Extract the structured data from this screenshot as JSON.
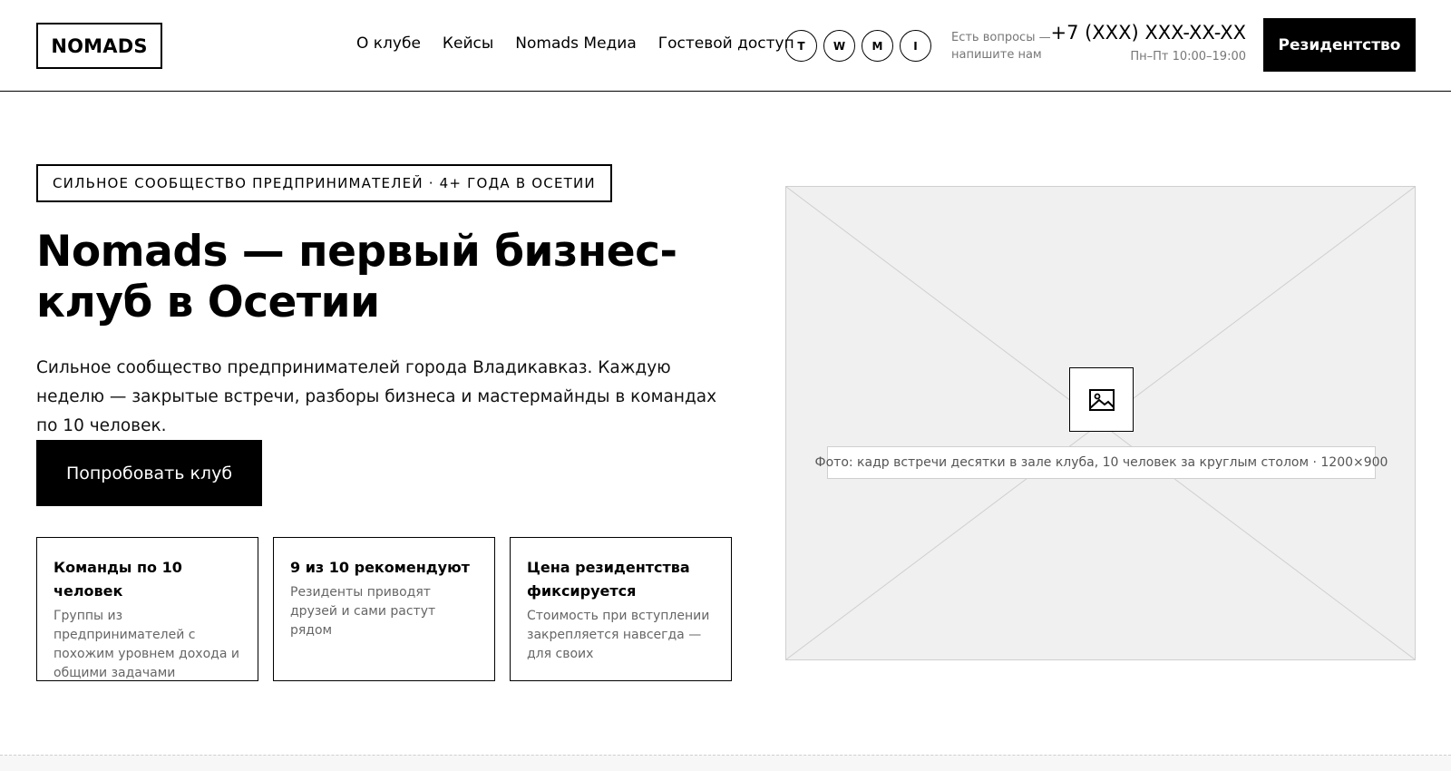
{
  "header": {
    "logo": "NOMADS",
    "nav": [
      {
        "label": "О клубе"
      },
      {
        "label": "Кейсы"
      },
      {
        "label": "Nomads Медиа"
      },
      {
        "label": "Гостевой доступ"
      }
    ],
    "socials": [
      {
        "letter": "T",
        "icon": "telegram-icon"
      },
      {
        "letter": "W",
        "icon": "whatsapp-icon"
      },
      {
        "letter": "M",
        "icon": "max-icon"
      },
      {
        "letter": "I",
        "icon": "instagram-icon"
      }
    ],
    "questions_line1": "Есть вопросы —",
    "questions_line2": "напишите нам",
    "phone": "+7 (XXX) XXX-XX-XX",
    "hours": "Пн–Пт 10:00–19:00",
    "cta": "Резидентство"
  },
  "hero": {
    "tag": "СИЛЬНОЕ СООБЩЕСТВО ПРЕДПРИНИМАТЕЛЕЙ · 4+ ГОДА В ОСЕТИИ",
    "title": "Nomads — первый бизнес-клуб в Осетии",
    "subtitle": "Сильное сообщество предпринимателей города Владикавказ. Каждую неделю — закрытые встречи, разборы бизнеса и мастермайнды в командах по 10 человек.",
    "cta": "Попробовать клуб",
    "features": [
      {
        "title": "Команды по 10 человек",
        "text": "Группы из предпринимателей с похожим уровнем дохода и общими задачами"
      },
      {
        "title": "9 из 10 рекомендуют",
        "text": "Резиденты приводят друзей и сами растут рядом"
      },
      {
        "title": "Цена резидентства фиксируется",
        "text": "Стоимость при вступлении закрепляется навсегда — для своих"
      }
    ]
  },
  "photo": {
    "icon": "image-icon",
    "caption": "Фото: кадр встречи десятки в зале клуба, 10 человек за круглым столом · 1200×900"
  },
  "colors": {
    "accent": "#000000",
    "muted": "#777777",
    "placeholder_bg": "#f0f0f0"
  }
}
